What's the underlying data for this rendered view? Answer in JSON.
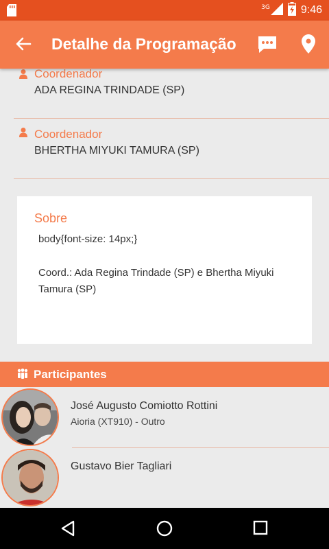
{
  "status_bar": {
    "time": "9:46",
    "network": "3G",
    "icons": [
      "sd-card-icon",
      "signal-icon",
      "battery-icon"
    ]
  },
  "app_bar": {
    "title": "Detalhe da Programação",
    "icons": [
      "back-arrow-icon",
      "chat-icon",
      "location-pin-icon"
    ]
  },
  "coordinators": [
    {
      "label": "Coordenador",
      "name": "ADA REGINA TRINDADE (SP)"
    },
    {
      "label": "Coordenador",
      "name": "BHERTHA MIYUKI TAMURA (SP)"
    }
  ],
  "about": {
    "heading": "Sobre",
    "css_text": "body{font-size: 14px;}",
    "description": "Coord.: Ada Regina Trindade (SP) e Bhertha Miyuki Tamura (SP)"
  },
  "participants_header": "Participantes",
  "participants": [
    {
      "name": "José Augusto Comiotto Rottini",
      "description": "Aioria (XT910) - Outro"
    },
    {
      "name": "Gustavo Bier Tagliari",
      "description": ""
    }
  ],
  "colors": {
    "accent": "#f47b4b",
    "status_bar": "#e5501f",
    "background": "#ebebeb"
  }
}
